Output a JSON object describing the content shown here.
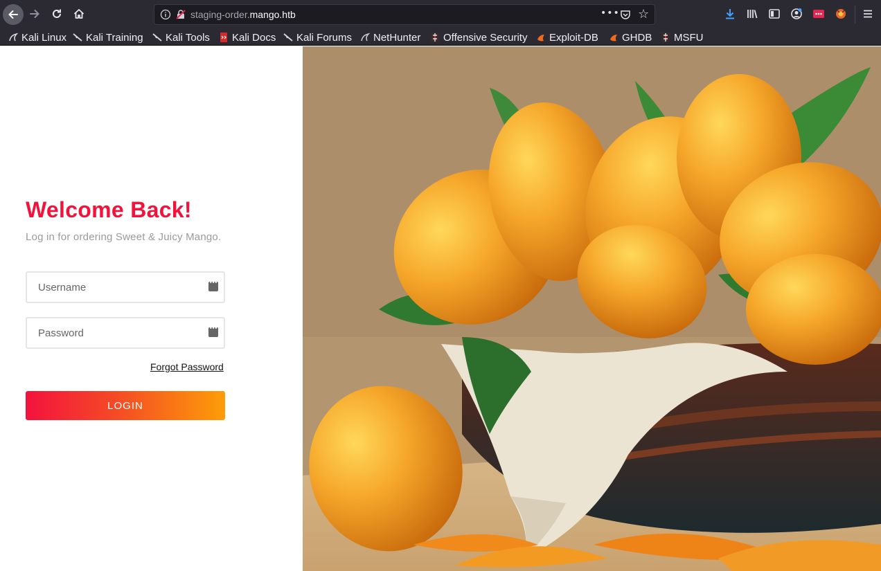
{
  "browser": {
    "url_prefix": "staging-order.",
    "url_domain": "mango.htb",
    "url_menu": "•••",
    "bookmarks": [
      {
        "label": "Kali Linux",
        "icon": "kali-dragon-icon"
      },
      {
        "label": "Kali Training",
        "icon": "kali-dragon-icon"
      },
      {
        "label": "Kali Tools",
        "icon": "kali-dragon-icon"
      },
      {
        "label": "Kali Docs",
        "icon": "kali-docs-icon"
      },
      {
        "label": "Kali Forums",
        "icon": "kali-dragon-icon"
      },
      {
        "label": "NetHunter",
        "icon": "nethunter-icon"
      },
      {
        "label": "Offensive Security",
        "icon": "offsec-icon"
      },
      {
        "label": "Exploit-DB",
        "icon": "exploitdb-icon"
      },
      {
        "label": "GHDB",
        "icon": "exploitdb-icon"
      },
      {
        "label": "MSFU",
        "icon": "offsec-icon"
      }
    ]
  },
  "login": {
    "title": "Welcome Back!",
    "subtitle": "Log in for ordering Sweet & Juicy Mango.",
    "username_placeholder": "Username",
    "password_placeholder": "Password",
    "forgot_label": "Forgot Password",
    "button_label": "LOGIN"
  },
  "colors": {
    "accent": "#f2133c",
    "button_gradient_start": "#f3123d",
    "button_gradient_end": "#fd9d08",
    "chrome": "#2b2a33"
  },
  "hero_image": {
    "icon": "mango-basket-photo"
  }
}
